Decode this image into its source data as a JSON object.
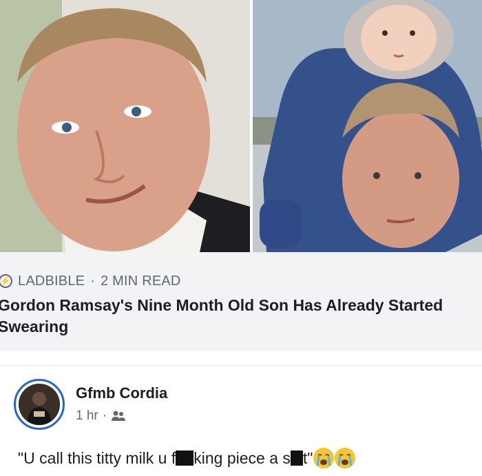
{
  "article": {
    "source": "LADBIBLE",
    "separator": "·",
    "read_time": "2 MIN READ",
    "headline": "Gordon Ramsay's Nine Month Old Son Has Already Started Swearing"
  },
  "comment": {
    "author": "Gfmb Cordia",
    "time": "1 hr",
    "meta_separator": "·",
    "text_part1": "\"U call this titty milk u f",
    "text_part2": "king piece a s",
    "text_part3": "t\"",
    "emojis": [
      "loudly-crying-face",
      "loudly-crying-face"
    ]
  },
  "colors": {
    "link_box_bg": "#f2f3f5",
    "avatar_ring": "#1f66d1",
    "secondary_text": "#606770",
    "primary_text": "#1c1e21"
  }
}
